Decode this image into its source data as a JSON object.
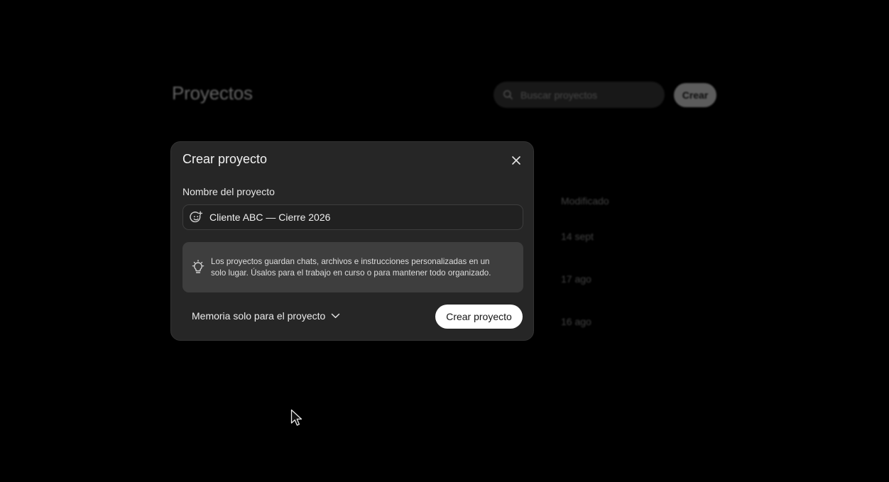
{
  "background": {
    "page_title": "Proyectos",
    "search": {
      "placeholder": "Buscar proyectos",
      "icon": "search-icon"
    },
    "create_button": "Crear",
    "column_header": "Modificado",
    "dates": [
      "14 sept",
      "17 ago",
      "16 ago"
    ]
  },
  "modal": {
    "title": "Crear proyecto",
    "close_icon": "close-icon",
    "name_label": "Nombre del proyecto",
    "name_value": "Cliente ABC — Cierre 2026",
    "emoji_icon": "emoji-add-icon",
    "info_icon": "lightbulb-icon",
    "info_text": "Los proyectos guardan chats, archivos e instrucciones personalizadas en un solo lugar. Úsalos para el trabajo en curso o para mantener todo organizado.",
    "memory_option": "Memoria solo para el proyecto",
    "create_button": "Crear proyecto"
  },
  "colors": {
    "page_bg": "#000000",
    "modal_bg": "#262626",
    "info_bg": "#3e3e3e",
    "primary_button_bg": "#ffffff"
  }
}
